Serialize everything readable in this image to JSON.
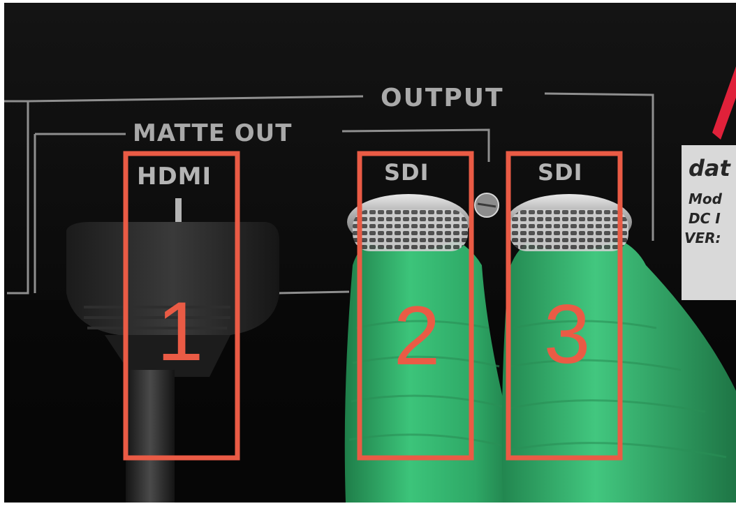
{
  "photo": {
    "section_labels": {
      "output": "OUTPUT",
      "matte_out": "MATTE OUT"
    },
    "ports": [
      {
        "label": "HDMI",
        "callout": "1"
      },
      {
        "label": "SDI",
        "callout": "2"
      },
      {
        "label": "SDI",
        "callout": "3"
      }
    ],
    "device_badge": {
      "brand_fragment": "dat",
      "lines": [
        "Mod",
        "DC I",
        "VER:"
      ]
    },
    "colors": {
      "background": "#0d0d0d",
      "panel_lines": "#8f8f8f",
      "callout_boxes": "#ea5b45",
      "cables": "#35b46a",
      "accent_mark": "#e0213a"
    }
  }
}
